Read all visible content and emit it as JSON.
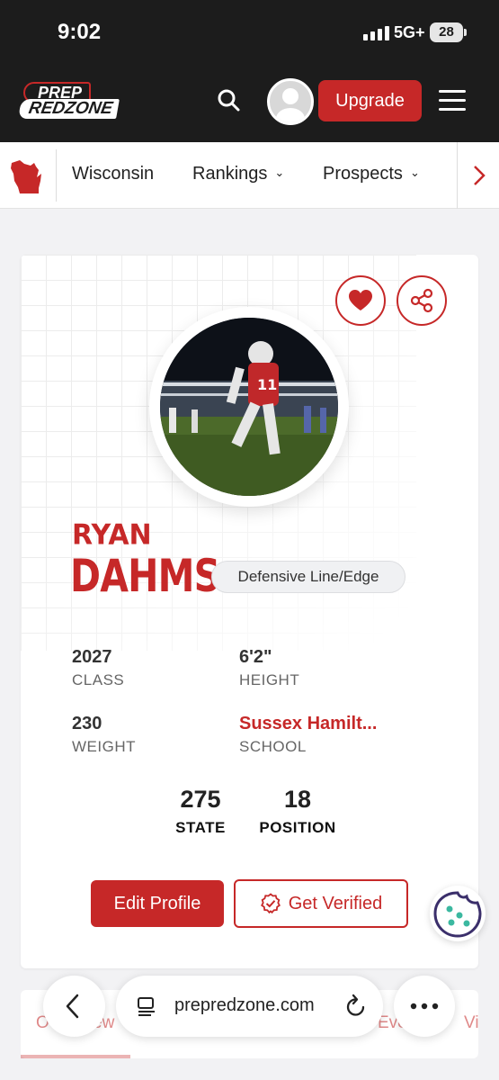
{
  "status_bar": {
    "time": "9:02",
    "network": "5G+",
    "battery": "28"
  },
  "header": {
    "logo_top": "PREP",
    "logo_bottom": "REDZONE",
    "upgrade_label": "Upgrade"
  },
  "nav": {
    "state": "Wisconsin",
    "items": [
      {
        "label": "Rankings"
      },
      {
        "label": "Prospects"
      }
    ]
  },
  "profile": {
    "first_name": "RYAN",
    "last_name": "DAHMS",
    "position": "Defensive Line/Edge",
    "stats": {
      "class_value": "2027",
      "class_label": "CLASS",
      "height_value": "6'2\"",
      "height_label": "HEIGHT",
      "weight_value": "230",
      "weight_label": "WEIGHT",
      "school_value": "Sussex Hamilt...",
      "school_label": "SCHOOL"
    },
    "rankings": {
      "state_value": "275",
      "state_label": "STATE",
      "position_value": "18",
      "position_label": "POSITION"
    },
    "edit_label": "Edit Profile",
    "verify_label": "Get Verified"
  },
  "tabs": {
    "first": "Ov",
    "second": "ew",
    "third": "Eve",
    "fourth": "Vi"
  },
  "browser": {
    "url": "prepredzone.com"
  },
  "colors": {
    "brand_red": "#c62828",
    "header_dark": "#1c1c1c"
  }
}
